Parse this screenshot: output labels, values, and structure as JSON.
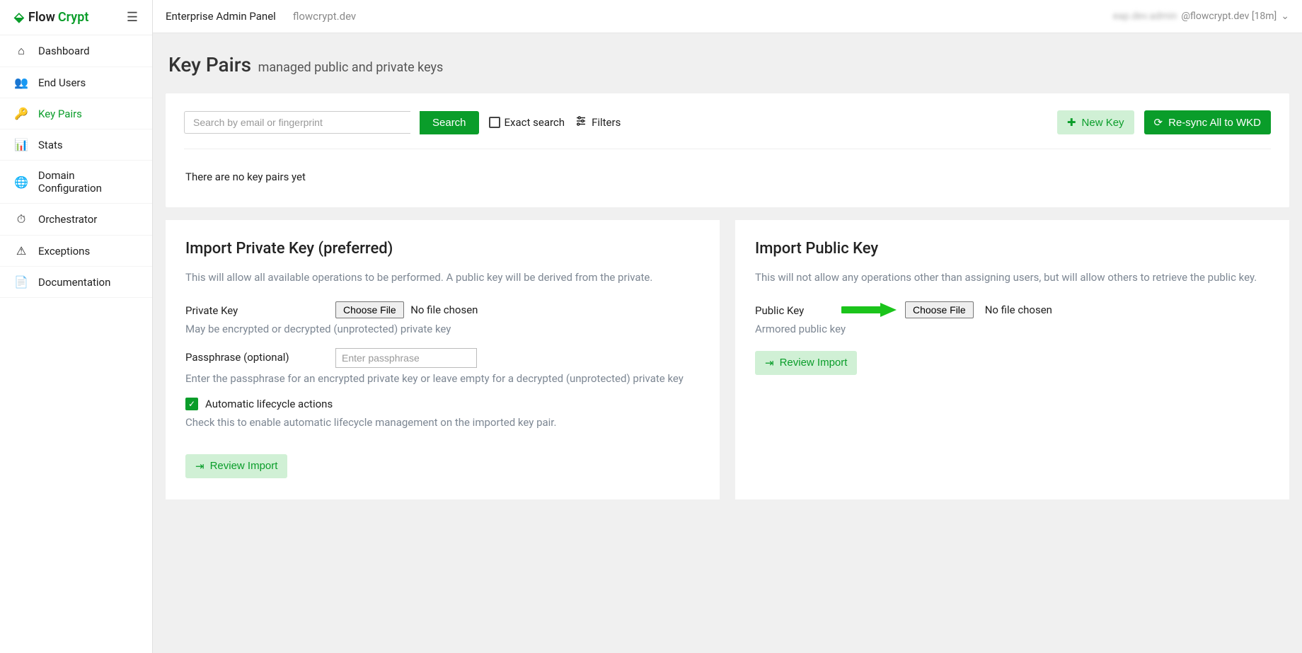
{
  "brand": {
    "flow": "Flow",
    "crypt": "Crypt"
  },
  "topbar": {
    "title": "Enterprise Admin Panel",
    "domain": "flowcrypt.dev",
    "user_hidden": "eap.dev.admin",
    "user_suffix": "@flowcrypt.dev [18m]"
  },
  "sidebar": {
    "items": [
      {
        "label": "Dashboard",
        "icon": "⌂"
      },
      {
        "label": "End Users",
        "icon": "👥"
      },
      {
        "label": "Key Pairs",
        "icon": "🔑"
      },
      {
        "label": "Stats",
        "icon": "📊"
      },
      {
        "label": "Domain Configuration",
        "icon": "🌐"
      },
      {
        "label": "Orchestrator",
        "icon": "⏱"
      },
      {
        "label": "Exceptions",
        "icon": "⚠"
      },
      {
        "label": "Documentation",
        "icon": "📄"
      }
    ]
  },
  "page": {
    "title": "Key Pairs",
    "subtitle": "managed public and private keys"
  },
  "search": {
    "placeholder": "Search by email or fingerprint",
    "button": "Search",
    "exact": "Exact search",
    "filters": "Filters",
    "new_key": "New Key",
    "resync": "Re-sync All to WKD",
    "empty": "There are no key pairs yet"
  },
  "importPrivate": {
    "title": "Import Private Key (preferred)",
    "desc": "This will allow all available operations to be performed. A public key will be derived from the private.",
    "fieldLabel": "Private Key",
    "chooseFile": "Choose File",
    "noFile": "No file chosen",
    "hint1": "May be encrypted or decrypted (unprotected) private key",
    "passLabel": "Passphrase (optional)",
    "passPlaceholder": "Enter passphrase",
    "hint2": "Enter the passphrase for an encrypted private key or leave empty for a decrypted (unprotected) private key",
    "autoLabel": "Automatic lifecycle actions",
    "autoHint": "Check this to enable automatic lifecycle management on the imported key pair.",
    "review": "Review Import"
  },
  "importPublic": {
    "title": "Import Public Key",
    "desc": "This will not allow any operations other than assigning users, but will allow others to retrieve the public key.",
    "fieldLabel": "Public Key",
    "chooseFile": "Choose File",
    "noFile": "No file chosen",
    "hint": "Armored public key",
    "review": "Review Import"
  }
}
